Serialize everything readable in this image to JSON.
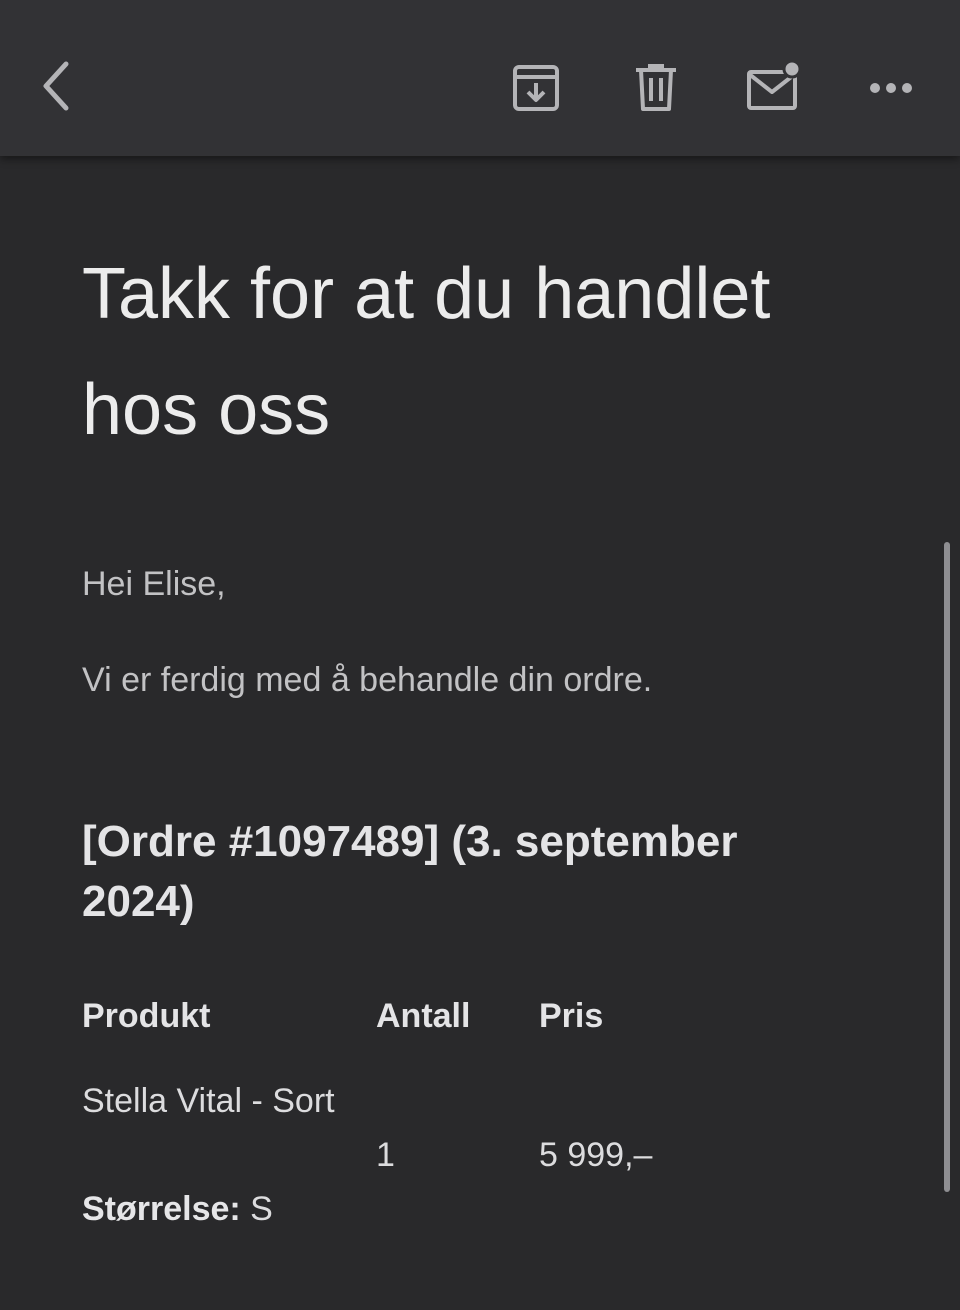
{
  "toolbar": {
    "icons": [
      "back-chevron-icon",
      "archive-icon",
      "trash-icon",
      "mark-unread-icon",
      "more-icon"
    ],
    "icon_color": "#b4b4b7"
  },
  "email": {
    "title": "Takk for at du handlet hos oss",
    "greeting": "Hei Elise,",
    "message": "Vi er ferdig med å behandle din ordre.",
    "order_heading": "[Ordre #1097489] (3. september 2024)",
    "table": {
      "headers": {
        "product": "Produkt",
        "quantity": "Antall",
        "price": "Pris"
      },
      "rows": [
        {
          "product": "Stella Vital - Sort",
          "quantity": "1",
          "price": "5 999,–",
          "variant_label": "Størrelse:",
          "variant_value": " S"
        }
      ]
    }
  },
  "colors": {
    "background": "#29292b",
    "toolbar": "#323235",
    "text_primary": "#ececec",
    "text_secondary": "#c2c2c4"
  }
}
